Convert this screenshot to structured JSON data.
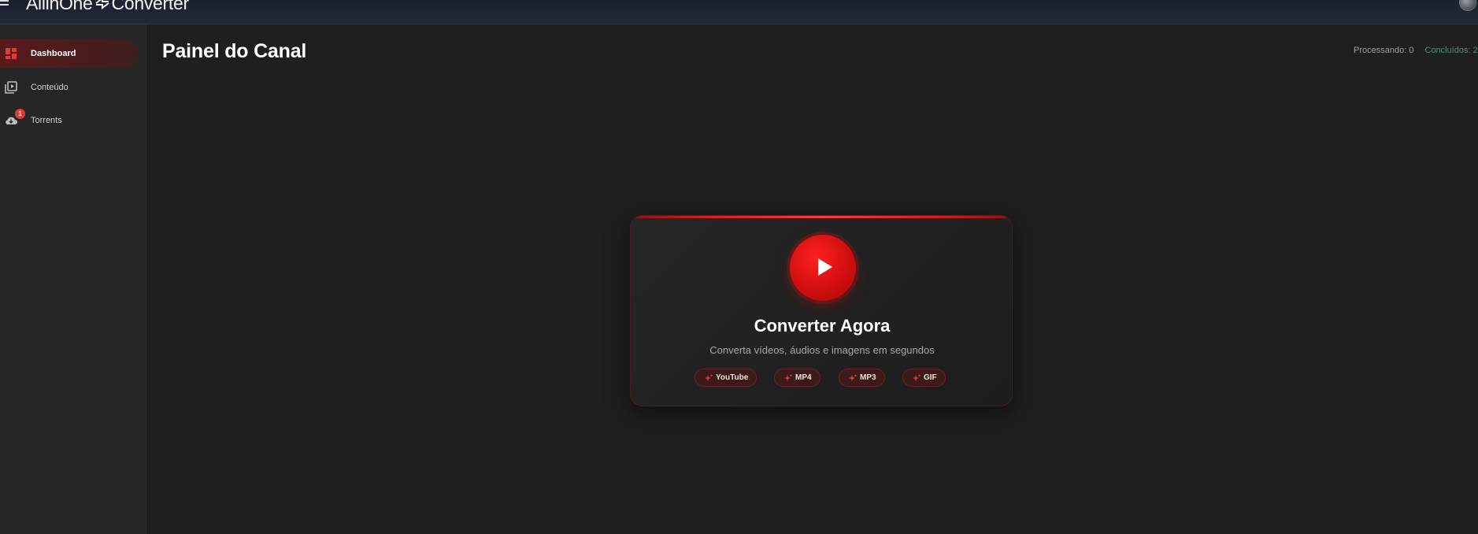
{
  "app": {
    "logo_text_left": "AllinOne",
    "logo_text_right": "Converter"
  },
  "sidebar": {
    "items": [
      {
        "label": "Dashboard",
        "icon": "dashboard-icon",
        "active": true
      },
      {
        "label": "Conteúdo",
        "icon": "video-library-icon",
        "active": false
      },
      {
        "label": "Torrents",
        "icon": "cloud-download-icon",
        "active": false,
        "badge": "1"
      }
    ]
  },
  "main": {
    "title": "Painel do Canal",
    "stats": {
      "processing": "Processando: 0",
      "completed": "Concluídos: 2"
    }
  },
  "card": {
    "title": "Converter Agora",
    "subtitle": "Converta vídeos, áudios e imagens em segundos",
    "chips": [
      "YouTube",
      "MP4",
      "MP3",
      "GIF"
    ]
  },
  "colors": {
    "accent": "#e01b1b",
    "background": "#1f1f1f",
    "sidebar": "#262626",
    "topbar": "#1c2130"
  }
}
